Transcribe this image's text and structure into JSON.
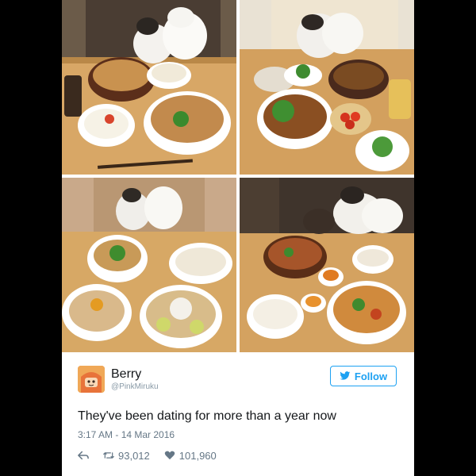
{
  "tweet": {
    "author_name": "Berry",
    "author_handle": "@PinkMiruku",
    "follow_label": "Follow",
    "text": "They've been dating for more than a year now",
    "timestamp": "3:17 AM - 14 Mar 2016",
    "retweets": "93,012",
    "likes": "101,960"
  },
  "photos": [
    {
      "subject": "two white and black cats behind a table with noodle soup and rice bowls"
    },
    {
      "subject": "two cats behind a table with ramen, tomatoes and rice"
    },
    {
      "subject": "two cats in a person's arms behind noodle bowls and rice"
    },
    {
      "subject": "two cats behind a table with stew, rice and pickles"
    }
  ],
  "icons": {
    "follow": "twitter-bird-icon",
    "reply": "reply-arrow-icon",
    "retweet": "retweet-icon",
    "like": "heart-icon"
  },
  "colors": {
    "accent": "#1da1f2",
    "text": "#14171a",
    "muted": "#657786",
    "background": "#000000"
  }
}
